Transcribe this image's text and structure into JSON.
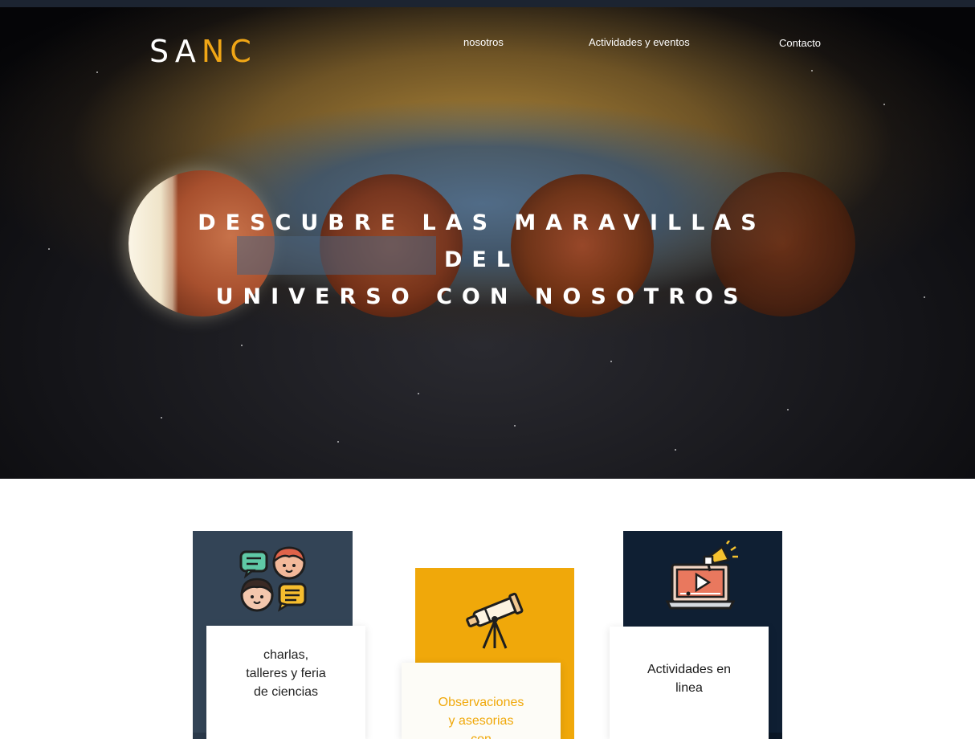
{
  "brand": {
    "logo_part1": "SA",
    "logo_part2": "NC"
  },
  "nav": {
    "items": [
      {
        "label": "nosotros"
      },
      {
        "label": "Actividades y eventos"
      },
      {
        "label": "Contacto"
      }
    ]
  },
  "hero": {
    "title_line1": "DESCUBRE LAS MARAVILLAS DEL",
    "title_line2": "UNIVERSO CON NOSOTROS"
  },
  "cards": [
    {
      "label_lines": [
        "charlas,",
        "talleres y feria",
        "de ciencias"
      ],
      "icon": "chat-people-icon",
      "color": "#334456"
    },
    {
      "label_lines": [
        "Observaciones",
        "y asesorias",
        "con"
      ],
      "icon": "telescope-icon",
      "color": "#f0a80a"
    },
    {
      "label_lines": [
        "Actividades en",
        "linea"
      ],
      "icon": "laptop-video-icon",
      "color": "#0f1f33"
    }
  ],
  "colors": {
    "accent": "#f0a616",
    "dark_blue": "#334456",
    "navy": "#0f1f33"
  }
}
